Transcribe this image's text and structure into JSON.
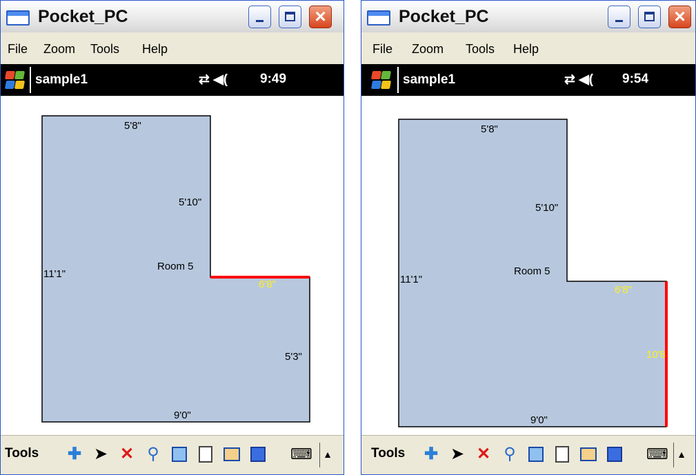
{
  "windows": [
    {
      "title": "Pocket_PC",
      "menu": [
        "File",
        "Zoom",
        "Tools",
        "Help"
      ],
      "doc_name": "sample1",
      "time": "9:49",
      "status_glyphs": "⇄ ◀(",
      "labels": {
        "top": "5'8\"",
        "inner_vertical": "5'10\"",
        "left": "11'1\"",
        "room": "Room 5",
        "step": "6'8\"",
        "right": "5'3\"",
        "bottom": "9'0\""
      },
      "highlighted_edge": "step",
      "toolbar_label": "Tools"
    },
    {
      "title": "Pocket_PC",
      "menu": [
        "File",
        "Zoom",
        "Tools",
        "Help"
      ],
      "doc_name": "sample1",
      "time": "9:54",
      "status_glyphs": "⇄ ◀(",
      "labels": {
        "top": "5'8\"",
        "inner_vertical": "5'10\"",
        "left": "11'1\"",
        "room": "Room 5",
        "step": "6'8\"",
        "right": "10'8",
        "bottom": "9'0\""
      },
      "highlighted_edge": "right",
      "toolbar_label": "Tools"
    }
  ],
  "toolbar_icons": [
    "add-icon",
    "pointer-icon",
    "delete-icon",
    "zoom-icon",
    "edit-icon",
    "notes-icon",
    "view-icon",
    "save-icon",
    "keyboard-icon",
    "up-arrow-icon"
  ],
  "colors": {
    "room_fill": "#b7c8de",
    "highlight": "#ff0000",
    "highlight_label": "#ffee20",
    "close_button": "#d8461e"
  }
}
